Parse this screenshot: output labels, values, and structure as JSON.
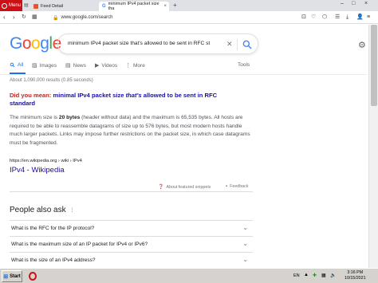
{
  "browser": {
    "menu_label": "Menu",
    "tabs": [
      {
        "label": "Feed Detail"
      },
      {
        "label": "minimum IPv4 packet size tha"
      }
    ],
    "url": "www.google.com/search"
  },
  "google": {
    "logo_letters": [
      {
        "ch": "G",
        "color": "#4285f4"
      },
      {
        "ch": "o",
        "color": "#ea4335"
      },
      {
        "ch": "o",
        "color": "#fbbc05"
      },
      {
        "ch": "g",
        "color": "#4285f4"
      },
      {
        "ch": "l",
        "color": "#34a853"
      },
      {
        "ch": "e",
        "color": "#ea4335"
      }
    ],
    "query": "minimum IPv4 packet size that's allowed to be sent in RFC st",
    "tabs": [
      {
        "label": "All",
        "icon": "search-icon"
      },
      {
        "label": "Images",
        "icon": "image-icon"
      },
      {
        "label": "News",
        "icon": "news-icon"
      },
      {
        "label": "Videos",
        "icon": "video-icon"
      },
      {
        "label": "More",
        "icon": "more-icon"
      }
    ],
    "tools_label": "Tools",
    "result_stats": "About 1,090,000 results (0.85 seconds)",
    "did_you_mean": {
      "label": "Did you mean:",
      "pre": "minimal IPv4 packet size",
      "italic": "that's",
      "post": "allowed to be sent in RFC standard"
    },
    "snippet": {
      "pre": "The minimum size is ",
      "bold": "20 bytes",
      "post": " (header without data) and the maximum is 65,535 bytes. All hosts are required to be able to reassemble datagrams of size up to 576 bytes, but most modern hosts handle much larger packets. Links may impose further restrictions on the packet size, in which case datagrams must be fragmented."
    },
    "cite": "https://en.wikipedia.org › wiki › IPv4",
    "result_title": "IPv4 - Wikipedia",
    "about_snippets": "About featured snippets",
    "feedback": "Feedback",
    "paa": {
      "title": "People also ask",
      "questions": [
        "What is the RFC for the IP protocol?",
        "What is the maximum size of an IP packet for IPv4 or IPv6?",
        "What is the size of an IPv4 address?"
      ]
    }
  },
  "taskbar": {
    "start_label": "Start",
    "lang": "EN",
    "time": "3:16 PM",
    "date": "10/15/2021"
  },
  "colors": {
    "google_blue": "#1a73e8",
    "link": "#1a0dab",
    "dym_red": "#c5221f",
    "opera_red": "#cc0f16"
  }
}
